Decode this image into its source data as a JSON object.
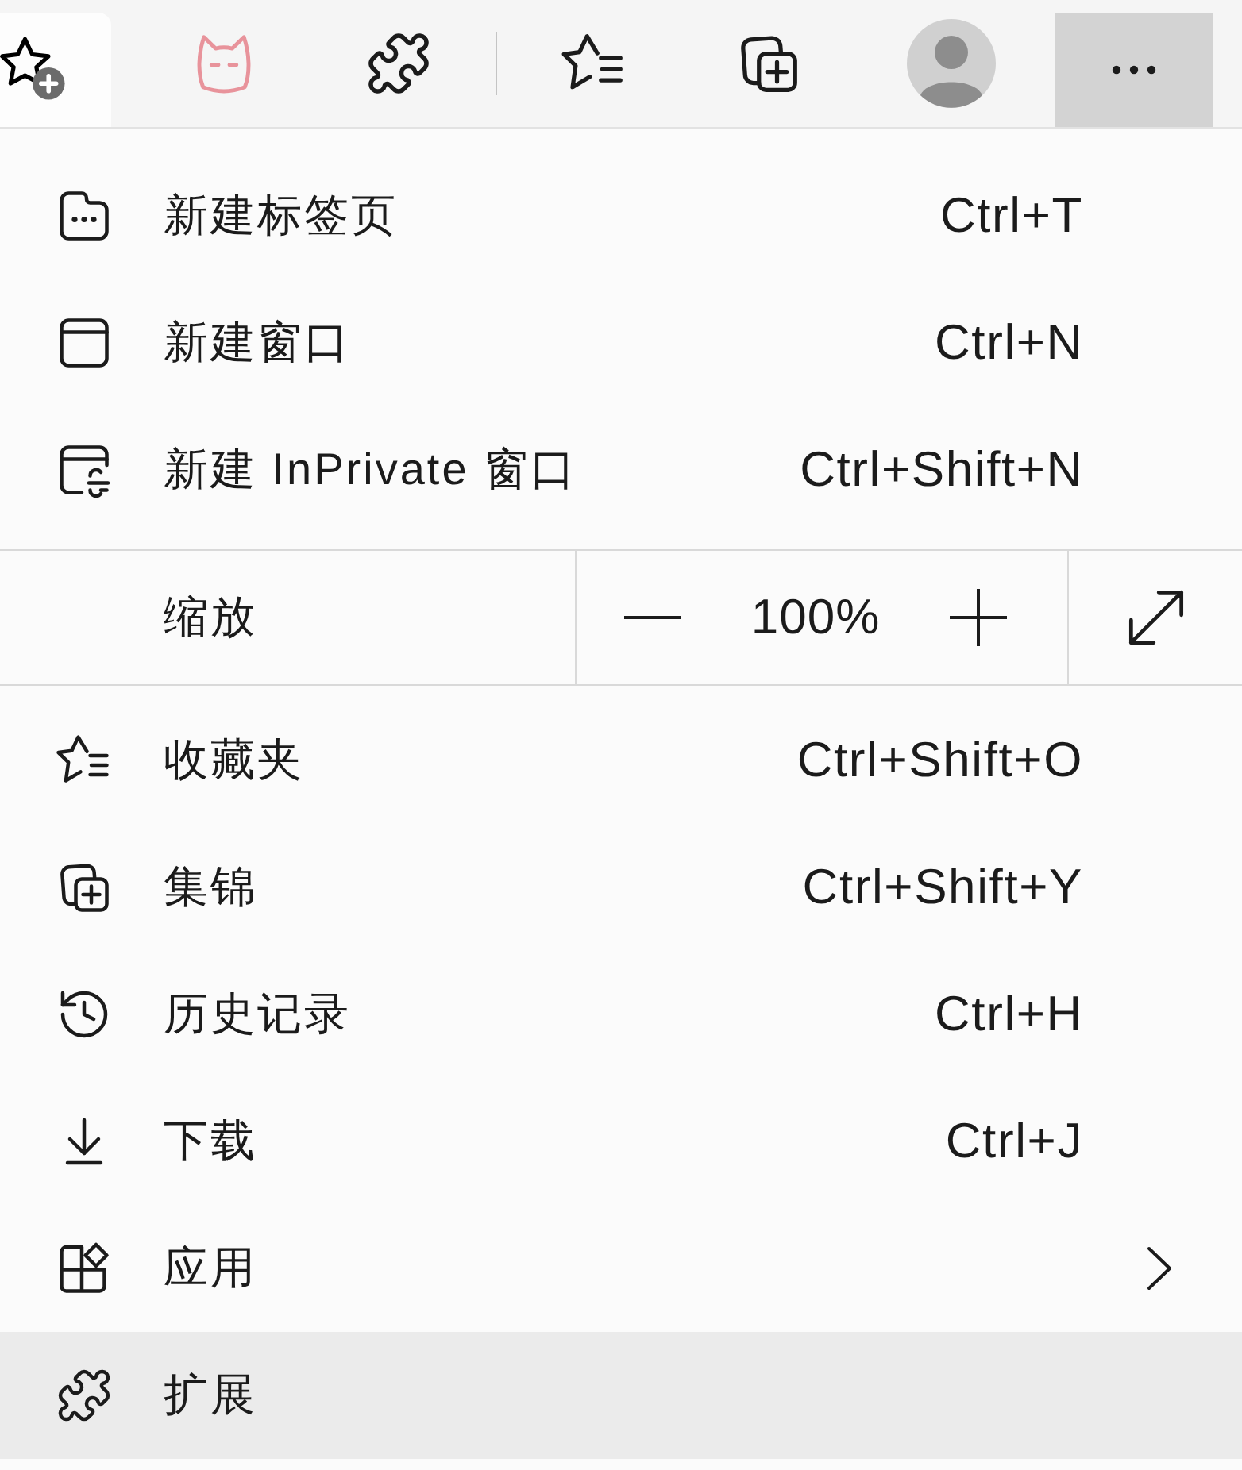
{
  "toolbar": {
    "menu_button": {
      "pressed": true
    }
  },
  "menu": {
    "items_top": [
      {
        "label": "新建标签页",
        "shortcut": "Ctrl+T",
        "submenu": false,
        "highlighted": false
      },
      {
        "label": "新建窗口",
        "shortcut": "Ctrl+N",
        "submenu": false,
        "highlighted": false
      },
      {
        "label": "新建 InPrivate 窗口",
        "shortcut": "Ctrl+Shift+N",
        "submenu": false,
        "highlighted": false
      }
    ],
    "zoom": {
      "label": "缩放",
      "value": "100%"
    },
    "items_bottom": [
      {
        "label": "收藏夹",
        "shortcut": "Ctrl+Shift+O",
        "submenu": false,
        "highlighted": false
      },
      {
        "label": "集锦",
        "shortcut": "Ctrl+Shift+Y",
        "submenu": false,
        "highlighted": false
      },
      {
        "label": "历史记录",
        "shortcut": "Ctrl+H",
        "submenu": false,
        "highlighted": false
      },
      {
        "label": "下载",
        "shortcut": "Ctrl+J",
        "submenu": false,
        "highlighted": false
      },
      {
        "label": "应用",
        "submenu": true,
        "highlighted": false
      },
      {
        "label": "扩展",
        "submenu": false,
        "highlighted": true
      }
    ]
  }
}
